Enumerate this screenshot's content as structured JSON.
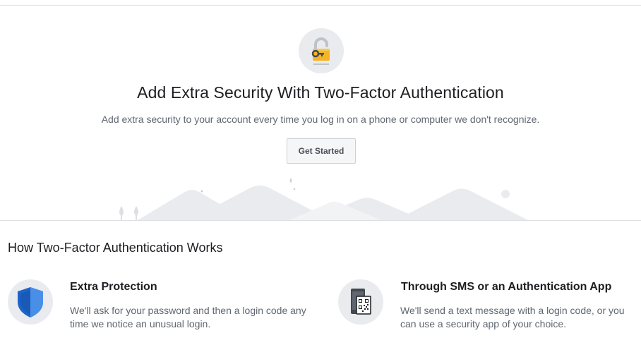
{
  "hero": {
    "icon": "lock-key-icon",
    "title": "Add Extra Security With Two-Factor Authentication",
    "subtitle": "Add extra security to your account every time you log in on a phone or computer we don't recognize.",
    "button_label": "Get Started"
  },
  "how_it_works": {
    "title": "How Two-Factor Authentication Works",
    "features": [
      {
        "icon": "shield-icon",
        "title": "Extra Protection",
        "description": "We'll ask for your password and then a login code any time we notice an unusual login."
      },
      {
        "icon": "phone-qr-icon",
        "title": "Through SMS or an Authentication App",
        "description": "We'll send a text message with a login code, or you can use a security app of your choice."
      }
    ]
  },
  "colors": {
    "lock_gold": "#f5b427",
    "shield_blue": "#1d64c9",
    "mountain_gray": "#e9ebee",
    "divider": "#dddfe2"
  }
}
